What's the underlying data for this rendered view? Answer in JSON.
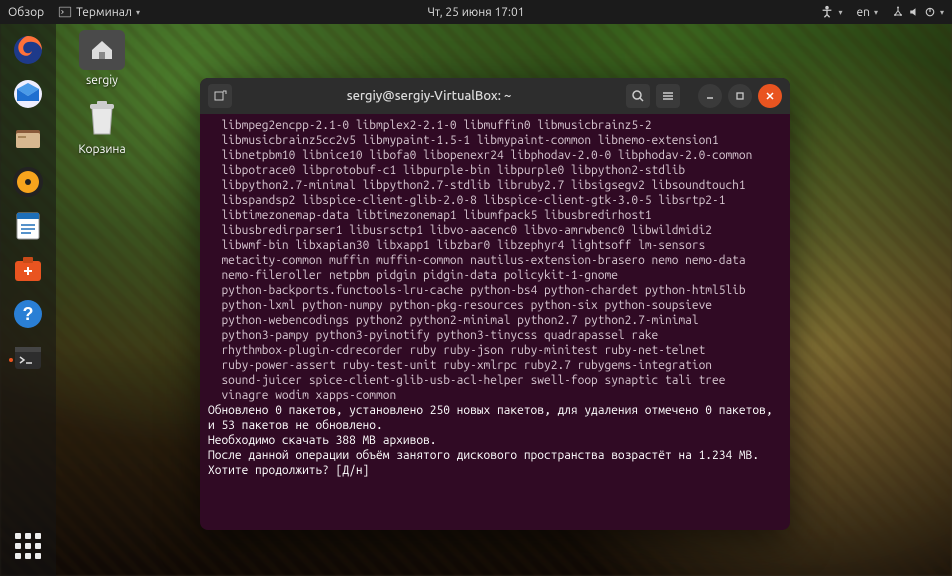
{
  "topbar": {
    "activities": "Обзор",
    "app_menu": "Терминал",
    "clock": "Чт, 25 июня  17:01",
    "lang": "en"
  },
  "desktop": {
    "home_label": "sergiy",
    "trash_label": "Корзина"
  },
  "dock": {
    "items": [
      {
        "name": "firefox",
        "color": "#ff7139"
      },
      {
        "name": "thunderbird",
        "color": "#1f6fd0"
      },
      {
        "name": "files",
        "color": "#dedede"
      },
      {
        "name": "rhythmbox",
        "color": "#f7a41d"
      },
      {
        "name": "libreoffice-writer",
        "color": "#1e6fb8"
      },
      {
        "name": "ubuntu-software",
        "color": "#e95420"
      },
      {
        "name": "help",
        "color": "#2a7fd5"
      },
      {
        "name": "terminal",
        "color": "#2d2d2d",
        "active": true
      }
    ]
  },
  "terminal": {
    "title": "sergiy@sergiy-VirtualBox: ~",
    "package_lines": [
      "libmpeg2encpp-2.1-0 libmplex2-2.1-0 libmuffin0 libmusicbrainz5-2",
      "libmusicbrainz5cc2v5 libmypaint-1.5-1 libmypaint-common libnemo-extension1",
      "libnetpbm10 libnice10 libofa0 libopenexr24 libphodav-2.0-0 libphodav-2.0-common",
      "libpotrace0 libprotobuf-c1 libpurple-bin libpurple0 libpython2-stdlib",
      "libpython2.7-minimal libpython2.7-stdlib libruby2.7 libsigsegv2 libsoundtouch1",
      "libspandsp2 libspice-client-glib-2.0-8 libspice-client-gtk-3.0-5 libsrtp2-1",
      "libtimezonemap-data libtimezonemap1 libumfpack5 libusbredirhost1",
      "libusbredirparser1 libusrsctp1 libvo-aacenc0 libvo-amrwbenc0 libwildmidi2",
      "libwmf-bin libxapian30 libxapp1 libzbar0 libzephyr4 lightsoff lm-sensors",
      "metacity-common muffin muffin-common nautilus-extension-brasero nemo nemo-data",
      "nemo-fileroller netpbm pidgin pidgin-data policykit-1-gnome",
      "python-backports.functools-lru-cache python-bs4 python-chardet python-html5lib",
      "python-lxml python-numpy python-pkg-resources python-six python-soupsieve",
      "python-webencodings python2 python2-minimal python2.7 python2.7-minimal",
      "python3-pampy python3-pyinotify python3-tinycss quadrapassel rake",
      "rhythmbox-plugin-cdrecorder ruby ruby-json ruby-minitest ruby-net-telnet",
      "ruby-power-assert ruby-test-unit ruby-xmlrpc ruby2.7 rubygems-integration",
      "sound-juicer spice-client-glib-usb-acl-helper swell-foop synaptic tali tree",
      "vinagre wodim xapps-common"
    ],
    "messages": [
      "Обновлено 0 пакетов, установлено 250 новых пакетов, для удаления отмечено 0 пакетов, и 53 пакетов не обновлено.",
      "Необходимо скачать 388 MB архивов.",
      "После данной операции объём занятого дискового пространства возрастёт на 1.234 MB.",
      "Хотите продолжить? [Д/н]"
    ]
  }
}
